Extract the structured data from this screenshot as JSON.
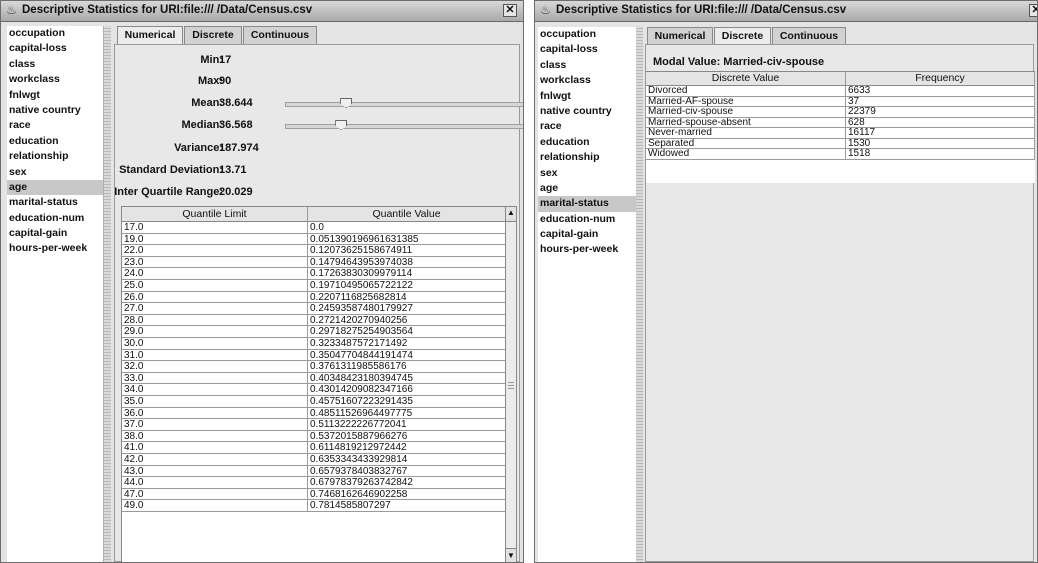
{
  "windows": [
    {
      "title": "Descriptive Statistics for URI:file:/// /Data/Census.csv",
      "close_glyph": "✕",
      "app_icon": "java-cup-icon",
      "attributes": [
        "occupation",
        "capital-loss",
        "class",
        "workclass",
        "fnlwgt",
        "native country",
        "race",
        "education",
        "relationship",
        "sex",
        "age",
        "marital-status",
        "education-num",
        "capital-gain",
        "hours-per-week"
      ],
      "selected_attribute": "age",
      "tabs": [
        "Numerical",
        "Discrete",
        "Continuous"
      ],
      "active_tab": "Numerical",
      "numerical": {
        "min_label": "Min:",
        "min_value": "17",
        "max_label": "Max:",
        "max_value": "90",
        "mean_label": "Mean:",
        "mean_value": "38.644",
        "median_label": "Median:",
        "median_value": "36.568",
        "variance_label": "Variance:",
        "variance_value": "187.974",
        "stddev_label": "Standard Deviation:",
        "stddev_value": "13.71",
        "iqr_label": "Inter Quartile Range:",
        "iqr_value": "20.029",
        "mean_slider_position": 0.22,
        "median_slider_position": 0.2,
        "table_headers": [
          "Quantile Limit",
          "Quantile Value"
        ],
        "quantiles": [
          [
            "17.0",
            "0.0"
          ],
          [
            "19.0",
            "0.051390196961631385"
          ],
          [
            "22.0",
            "0.12073625158674911"
          ],
          [
            "23.0",
            "0.14794643953974038"
          ],
          [
            "24.0",
            "0.17263830309979114"
          ],
          [
            "25.0",
            "0.19710495065722122"
          ],
          [
            "26.0",
            "0.2207116825682814"
          ],
          [
            "27.0",
            "0.24593587480179927"
          ],
          [
            "28.0",
            "0.2721420270940256"
          ],
          [
            "29.0",
            "0.29718275254903564"
          ],
          [
            "30.0",
            "0.3233487572171492"
          ],
          [
            "31.0",
            "0.35047704844191474"
          ],
          [
            "32.0",
            "0.3761311985586176"
          ],
          [
            "33.0",
            "0.40348423180394745"
          ],
          [
            "34.0",
            "0.43014209082347166"
          ],
          [
            "35.0",
            "0.45751607223291435"
          ],
          [
            "36.0",
            "0.48511526964497775"
          ],
          [
            "37.0",
            "0.5113222226772041"
          ],
          [
            "38.0",
            "0.5372015887966276"
          ],
          [
            "41.0",
            "0.6114819212972442"
          ],
          [
            "42.0",
            "0.6353343433929814"
          ],
          [
            "43.0",
            "0.6579378403832767"
          ],
          [
            "44.0",
            "0.67978379263742842"
          ],
          [
            "47.0",
            "0.7468162646902258"
          ],
          [
            "49.0",
            "0.7814585807297"
          ]
        ],
        "scroll_up": "▲",
        "scroll_down": "▼"
      }
    },
    {
      "title": "Descriptive Statistics for URI:file:/// /Data/Census.csv",
      "close_glyph": "✕",
      "app_icon": "java-cup-icon",
      "attributes": [
        "occupation",
        "capital-loss",
        "class",
        "workclass",
        "fnlwgt",
        "native country",
        "race",
        "education",
        "relationship",
        "sex",
        "age",
        "marital-status",
        "education-num",
        "capital-gain",
        "hours-per-week"
      ],
      "selected_attribute": "marital-status",
      "tabs": [
        "Numerical",
        "Discrete",
        "Continuous"
      ],
      "active_tab": "Discrete",
      "discrete": {
        "modal_value": "Modal Value: Married-civ-spouse",
        "table_headers": [
          "Discrete Value",
          "Frequency"
        ],
        "rows": [
          [
            "Divorced",
            "6633"
          ],
          [
            "Married-AF-spouse",
            "37"
          ],
          [
            "Married-civ-spouse",
            "22379"
          ],
          [
            "Married-spouse-absent",
            "628"
          ],
          [
            "Never-married",
            "16117"
          ],
          [
            "Separated",
            "1530"
          ],
          [
            "Widowed",
            "1518"
          ]
        ]
      }
    }
  ]
}
